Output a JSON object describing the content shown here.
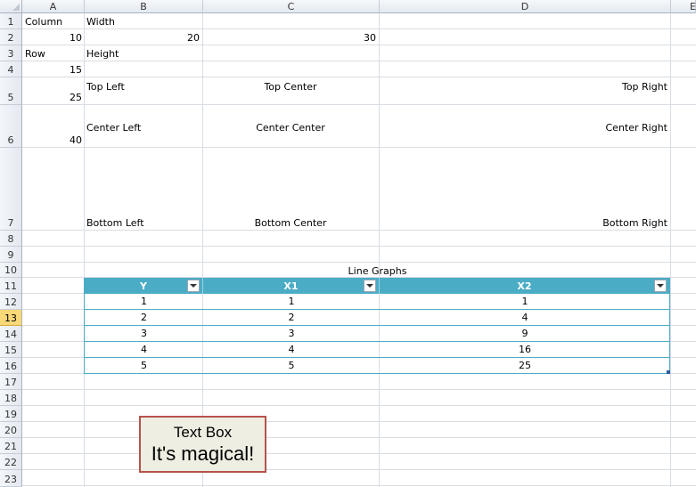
{
  "columns": [
    "A",
    "B",
    "C",
    "D",
    "E"
  ],
  "rows": [
    "1",
    "2",
    "3",
    "4",
    "5",
    "6",
    "7",
    "8",
    "9",
    "10",
    "11",
    "12",
    "13",
    "14",
    "15",
    "16",
    "17",
    "18",
    "19",
    "20",
    "21",
    "22",
    "23"
  ],
  "selected_row": "13",
  "cells": {
    "a1": "Column",
    "b1": "Width",
    "a2": "10",
    "b2": "20",
    "c2": "30",
    "a3": "Row",
    "b3": "Height",
    "a4": "15",
    "a5": "25",
    "a6": "40",
    "b5": "Top Left",
    "c5": "Top Center",
    "d5": "Top Right",
    "b6": "Center Left",
    "c6": "Center Center",
    "d6": "Center Right",
    "b7": "Bottom Left",
    "c7": "Bottom Center",
    "d7": "Bottom Right",
    "c10": "Line Graphs"
  },
  "table": {
    "headers": [
      "Y",
      "X1",
      "X2"
    ],
    "rows": [
      [
        "1",
        "1",
        "1"
      ],
      [
        "2",
        "2",
        "4"
      ],
      [
        "3",
        "3",
        "9"
      ],
      [
        "4",
        "4",
        "16"
      ],
      [
        "5",
        "5",
        "25"
      ]
    ],
    "header_color": "#4bacc6"
  },
  "textbox": {
    "line1": "Text Box",
    "line2": "It's magical!"
  }
}
